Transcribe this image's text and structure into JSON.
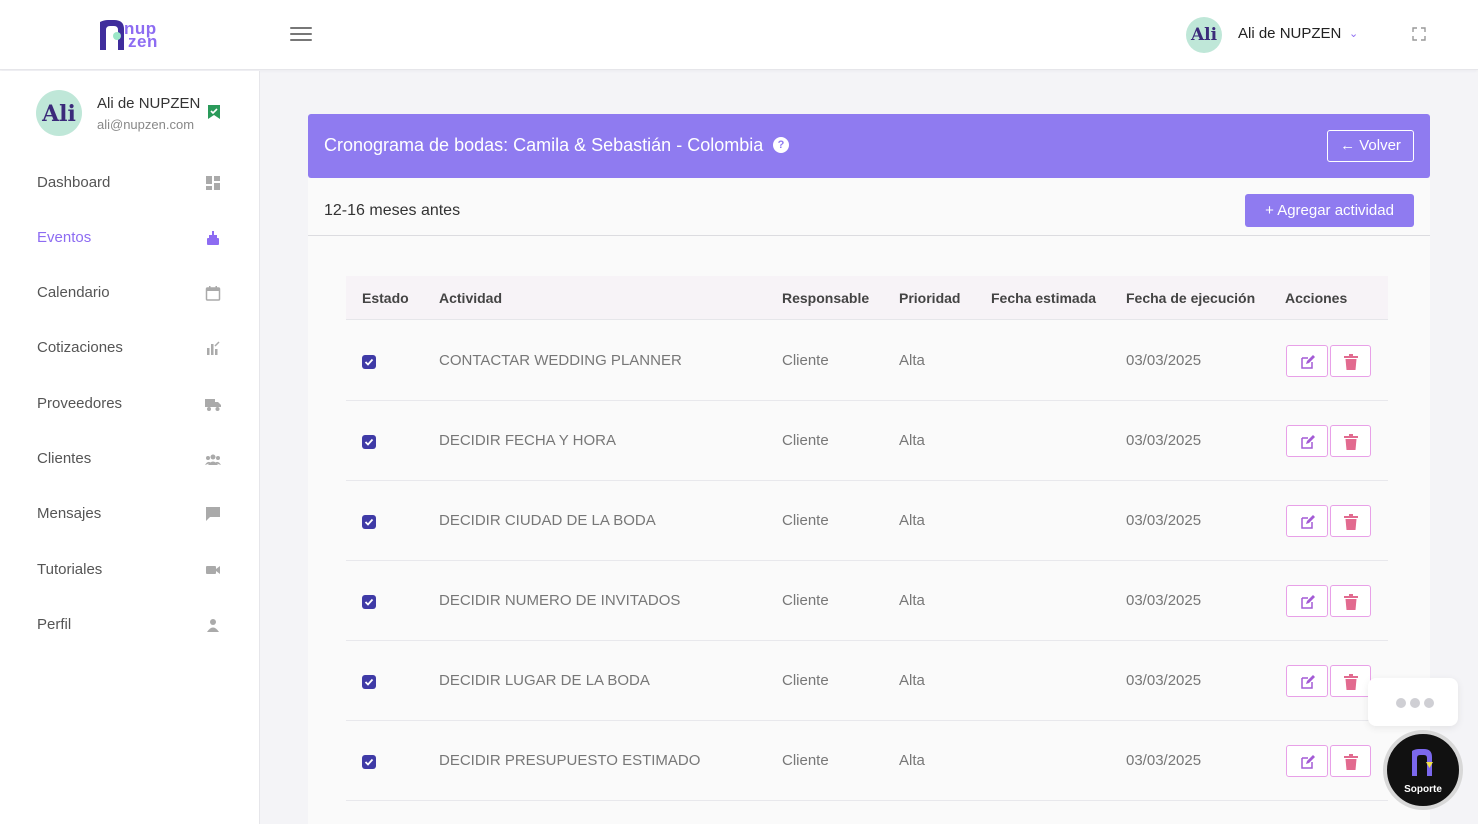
{
  "app": {
    "logo_line1": "nup",
    "logo_line2": "zen",
    "colors": {
      "accent": "#8f7bf0",
      "checkbox": "#3f3aa6",
      "action_border": "#e8a0e8",
      "edit_icon": "#a45bd6",
      "delete_icon": "#e26a8f"
    }
  },
  "header": {
    "user_name": "Ali de NUPZEN",
    "avatar_text": "Ali",
    "icons": [
      "hamburger-icon",
      "chevron-down-icon",
      "fullscreen-icon"
    ]
  },
  "sidebar": {
    "profile": {
      "name": "Ali de NUPZEN",
      "email": "ali@nupzen.com",
      "avatar_text": "Ali"
    },
    "items": [
      {
        "label": "Dashboard",
        "icon": "dashboard-icon",
        "active": false
      },
      {
        "label": "Eventos",
        "icon": "cake-icon",
        "active": true
      },
      {
        "label": "Calendario",
        "icon": "calendar-icon",
        "active": false
      },
      {
        "label": "Cotizaciones",
        "icon": "chart-icon",
        "active": false
      },
      {
        "label": "Proveedores",
        "icon": "truck-icon",
        "active": false
      },
      {
        "label": "Clientes",
        "icon": "users-icon",
        "active": false
      },
      {
        "label": "Mensajes",
        "icon": "message-icon",
        "active": false
      },
      {
        "label": "Tutoriales",
        "icon": "video-icon",
        "active": false
      },
      {
        "label": "Perfil",
        "icon": "user-icon",
        "active": false
      }
    ]
  },
  "page": {
    "title": "Cronograma de bodas: Camila & Sebastián - Colombia",
    "help": "?",
    "back_label": "Volver",
    "section_title": "12-16 meses antes",
    "add_label": "Agregar actividad"
  },
  "table": {
    "columns": [
      "Estado",
      "Actividad",
      "Responsable",
      "Prioridad",
      "Fecha estimada",
      "Fecha de ejecución",
      "Acciones"
    ],
    "rows": [
      {
        "checked": true,
        "activity": "CONTACTAR WEDDING PLANNER",
        "responsible": "Cliente",
        "priority": "Alta",
        "estimated": "",
        "executed": "03/03/2025"
      },
      {
        "checked": true,
        "activity": "DECIDIR FECHA Y HORA",
        "responsible": "Cliente",
        "priority": "Alta",
        "estimated": "",
        "executed": "03/03/2025"
      },
      {
        "checked": true,
        "activity": "DECIDIR CIUDAD DE LA BODA",
        "responsible": "Cliente",
        "priority": "Alta",
        "estimated": "",
        "executed": "03/03/2025"
      },
      {
        "checked": true,
        "activity": "DECIDIR NUMERO DE INVITADOS",
        "responsible": "Cliente",
        "priority": "Alta",
        "estimated": "",
        "executed": "03/03/2025"
      },
      {
        "checked": true,
        "activity": "DECIDIR LUGAR DE LA BODA",
        "responsible": "Cliente",
        "priority": "Alta",
        "estimated": "",
        "executed": "03/03/2025"
      },
      {
        "checked": true,
        "activity": "DECIDIR PRESUPUESTO ESTIMADO",
        "responsible": "Cliente",
        "priority": "Alta",
        "estimated": "",
        "executed": "03/03/2025"
      }
    ]
  },
  "support": {
    "label": "Soporte"
  }
}
